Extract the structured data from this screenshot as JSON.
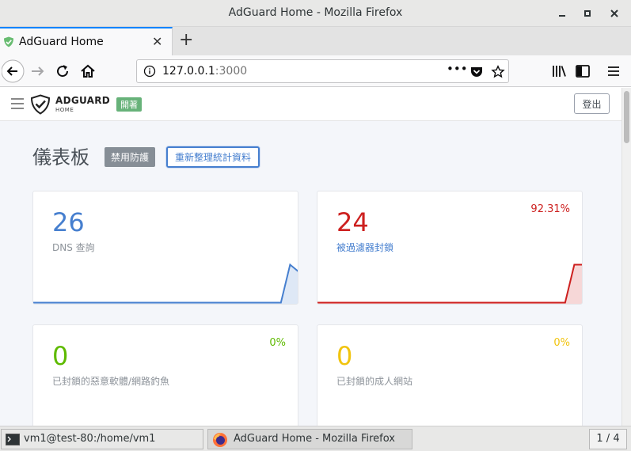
{
  "window": {
    "title": "AdGuard Home - Mozilla Firefox"
  },
  "browser": {
    "tab_label": "AdGuard Home",
    "url_host": "127.0.0.1",
    "url_port": ":3000",
    "page_actions_label": "•••"
  },
  "app": {
    "brand": "ADGUARD",
    "brand_sub": "HOME",
    "status": "開著",
    "logout": "登出",
    "page_title": "儀表板",
    "disable_protection": "禁用防護",
    "refresh_stats": "重新整理統計資料"
  },
  "cards": [
    {
      "value": "26",
      "label": "DNS 查詢",
      "percent": "",
      "color": "#467fcf",
      "spark": [
        0,
        0,
        0,
        0,
        0,
        0,
        0,
        0,
        0,
        0,
        0,
        0,
        0,
        0,
        0,
        0,
        0,
        0,
        0,
        0,
        0,
        0,
        0,
        0,
        0,
        0,
        0,
        0,
        1,
        0.8
      ]
    },
    {
      "value": "24",
      "label": "被過濾器封鎖",
      "percent": "92.31%",
      "color": "#cd201f",
      "spark": [
        0,
        0,
        0,
        0,
        0,
        0,
        0,
        0,
        0,
        0,
        0,
        0,
        0,
        0,
        0,
        0,
        0,
        0,
        0,
        0,
        0,
        0,
        0,
        0,
        0,
        0,
        0,
        0,
        1,
        1
      ]
    },
    {
      "value": "0",
      "label": "已封鎖的惡意軟體/網路釣魚",
      "percent": "0%",
      "color": "#5eba00",
      "spark": []
    },
    {
      "value": "0",
      "label": "已封鎖的成人網站",
      "percent": "0%",
      "color": "#f1c40f",
      "spark": []
    }
  ],
  "colors": {
    "blue_accent": "#467fcf",
    "red_accent": "#cd201f",
    "green_accent": "#5eba00",
    "yellow_accent": "#f1c40f",
    "status_green": "#67b279"
  },
  "taskbar": {
    "terminal_label": "vm1@test-80:/home/vm1",
    "firefox_label": "AdGuard Home - Mozilla Firefox",
    "workspace": "1 / 4"
  }
}
